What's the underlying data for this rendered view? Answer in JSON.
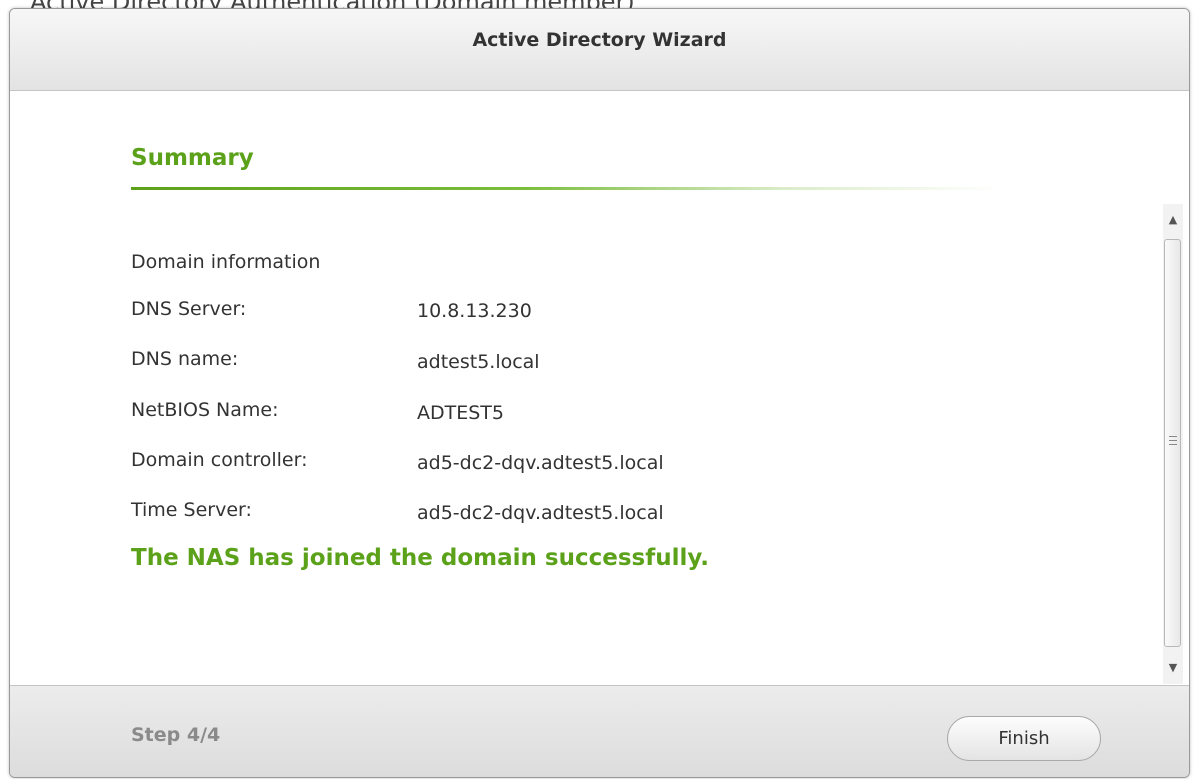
{
  "background_app": {
    "partial_text": "Active Directory Authentication (Domain member)"
  },
  "dialog": {
    "title": "Active Directory Wizard"
  },
  "summary": {
    "heading": "Summary",
    "info_heading": "Domain information",
    "rows": [
      {
        "label": "DNS Server:",
        "value": "10.8.13.230"
      },
      {
        "label": "DNS name:",
        "value": "adtest5.local"
      },
      {
        "label": "NetBIOS Name:",
        "value": "ADTEST5"
      },
      {
        "label": "Domain controller:",
        "value": "ad5-dc2-dqv.adtest5.local"
      },
      {
        "label": "Time Server:",
        "value": "ad5-dc2-dqv.adtest5.local"
      }
    ],
    "success_message": "The NAS has joined the domain successfully."
  },
  "footer": {
    "step": "Step 4/4",
    "finish_label": "Finish"
  },
  "icons": {
    "scroll_up": "scroll-up-arrow-icon",
    "scroll_down": "scroll-down-arrow-icon",
    "grip": "scroll-grip-icon"
  },
  "colors": {
    "accent_green": "#5ba11a",
    "step_gray": "#8a8a8a"
  }
}
